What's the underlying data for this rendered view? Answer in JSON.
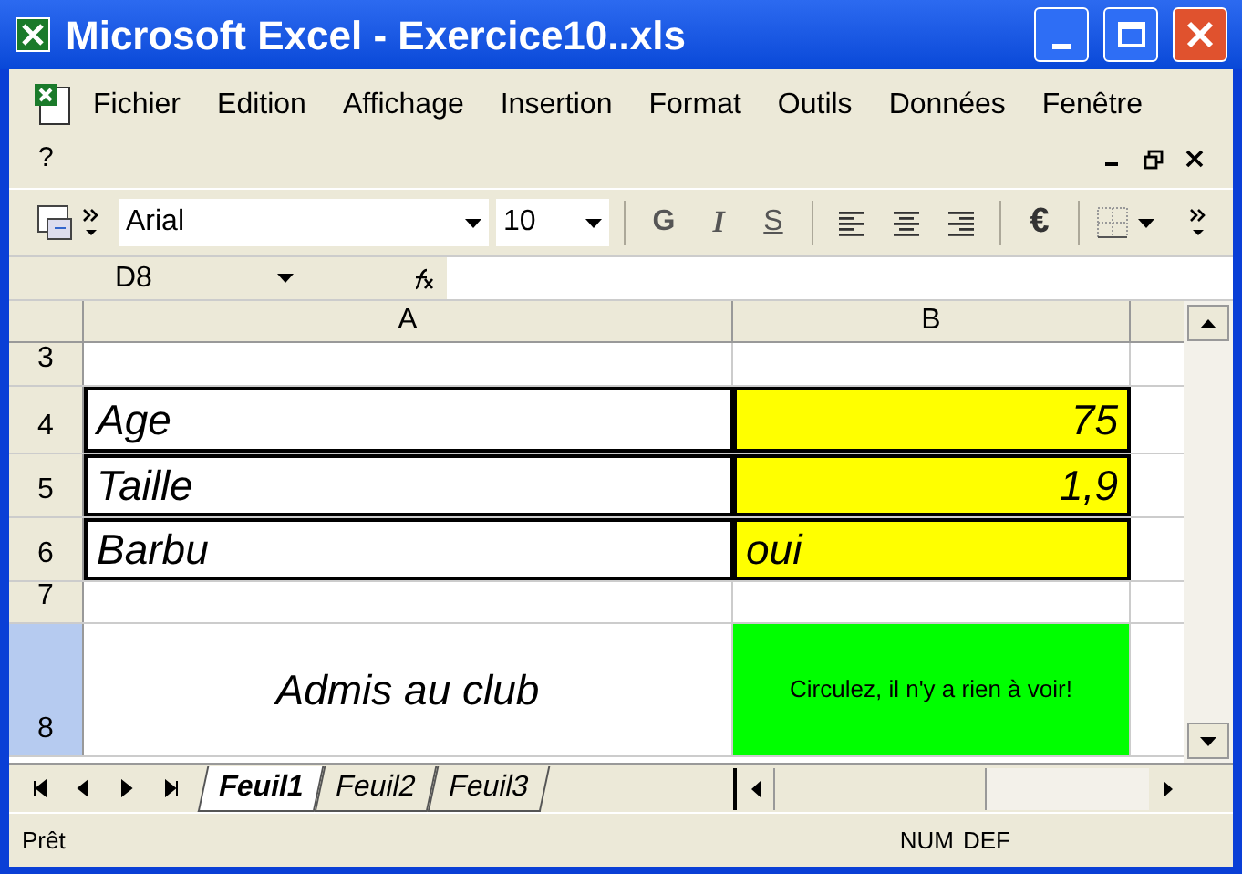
{
  "window": {
    "title": "Microsoft Excel - Exercice10..xls"
  },
  "menu": [
    "Fichier",
    "Edition",
    "Affichage",
    "Insertion",
    "Format",
    "Outils",
    "Données",
    "Fenêtre",
    "?"
  ],
  "toolbar": {
    "font": "Arial",
    "size": "10",
    "bold": "G",
    "italic": "I",
    "underline": "S",
    "currency": "€"
  },
  "formula_bar": {
    "name_box": "D8"
  },
  "columns": [
    "A",
    "B"
  ],
  "rows": [
    {
      "header": "3",
      "cells": [
        {
          "color": "#ffffff",
          "boxed": false
        },
        {
          "color": "#ffffff",
          "boxed": false
        }
      ]
    },
    {
      "header": "4",
      "cells": [
        {
          "text": "Age",
          "color": "#ffffff",
          "boxed": true,
          "kind": "left"
        },
        {
          "text": "75",
          "color": "#ffff00",
          "boxed": true,
          "kind": "right"
        }
      ]
    },
    {
      "header": "5",
      "cells": [
        {
          "text": "Taille",
          "color": "#ffffff",
          "boxed": true,
          "kind": "left"
        },
        {
          "text": "1,9",
          "color": "#ffff00",
          "boxed": true,
          "kind": "right"
        }
      ]
    },
    {
      "header": "6",
      "cells": [
        {
          "text": "Barbu",
          "color": "#ffffff",
          "boxed": true,
          "kind": "left"
        },
        {
          "text": "oui",
          "color": "#ffff00",
          "boxed": true,
          "kind": "left"
        }
      ]
    },
    {
      "header": "7",
      "cells": [
        {
          "color": "#ffffff",
          "boxed": false
        },
        {
          "color": "#ffffff",
          "boxed": false
        }
      ]
    },
    {
      "header": "8",
      "selected": true,
      "cells": [
        {
          "text": "Admis au club",
          "color": "#ffffff",
          "boxed": false,
          "kind": "center"
        },
        {
          "text": "Circulez, il n'y a rien à voir!",
          "color": "#00ff00",
          "boxed": false,
          "kind": "center",
          "small": true
        }
      ]
    }
  ],
  "sheets": [
    {
      "label": "Feuil1",
      "selected": true
    },
    {
      "label": "Feuil2",
      "selected": false
    },
    {
      "label": "Feuil3",
      "selected": false
    }
  ],
  "status_bar": {
    "text": "Prêt",
    "indicators": [
      "NUM",
      "DEF"
    ]
  }
}
